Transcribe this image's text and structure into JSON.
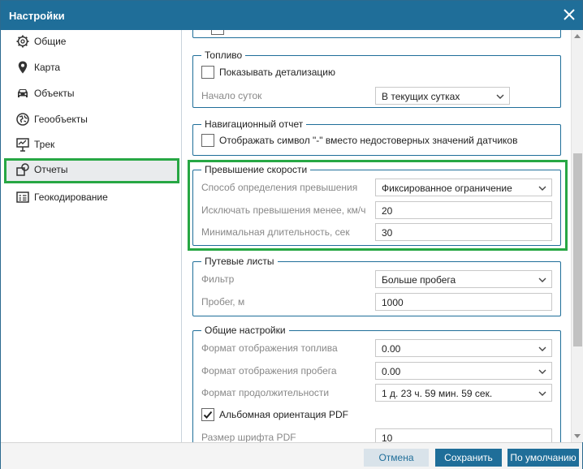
{
  "window": {
    "title": "Настройки"
  },
  "sidebar": {
    "items": [
      {
        "label": "Общие",
        "icon": "gear-icon"
      },
      {
        "label": "Карта",
        "icon": "map-pin-icon"
      },
      {
        "label": "Объекты",
        "icon": "car-icon"
      },
      {
        "label": "Геообъекты",
        "icon": "geo-objects-icon"
      },
      {
        "label": "Трек",
        "icon": "track-icon"
      },
      {
        "label": "Отчеты",
        "icon": "reports-icon",
        "active": true
      },
      {
        "label": "Геокодирование",
        "icon": "geocoding-icon"
      }
    ]
  },
  "fuel": {
    "legend": "Топливо",
    "show_detail_label": "Показывать детализацию",
    "show_detail_checked": false,
    "day_start_label": "Начало суток",
    "day_start_value": "В текущих сутках"
  },
  "nav_report": {
    "legend": "Навигационный отчет",
    "symbol_label": "Отображать символ \"-\" вместо недостоверных значений датчиков",
    "symbol_checked": false
  },
  "speeding": {
    "legend": "Превышение скорости",
    "method_label": "Способ определения превышения",
    "method_value": "Фиксированное ограничение",
    "exclude_label": "Исключать превышения менее, км/ч",
    "exclude_value": "20",
    "min_duration_label": "Минимальная длительность, сек",
    "min_duration_value": "30"
  },
  "waybills": {
    "legend": "Путевые листы",
    "filter_label": "Фильтр",
    "filter_value": "Больше пробега",
    "mileage_label": "Пробег, м",
    "mileage_value": "1000"
  },
  "general": {
    "legend": "Общие настройки",
    "fuel_format_label": "Формат отображения топлива",
    "fuel_format_value": "0.00",
    "mileage_format_label": "Формат отображения пробега",
    "mileage_format_value": "0.00",
    "duration_format_label": "Формат продолжительности",
    "duration_format_value": "1 д. 23 ч. 59 мин. 59 сек.",
    "pdf_landscape_label": "Альбомная ориентация PDF",
    "pdf_landscape_checked": true,
    "pdf_font_label": "Размер шрифта PDF",
    "pdf_font_value": "10"
  },
  "footer": {
    "cancel_label": "Отмена",
    "save_label": "Сохранить",
    "default_label": "По умолчанию"
  },
  "colors": {
    "titlebar": "#1f6e99",
    "highlight": "#27a744",
    "group_border": "#1f6e99"
  }
}
